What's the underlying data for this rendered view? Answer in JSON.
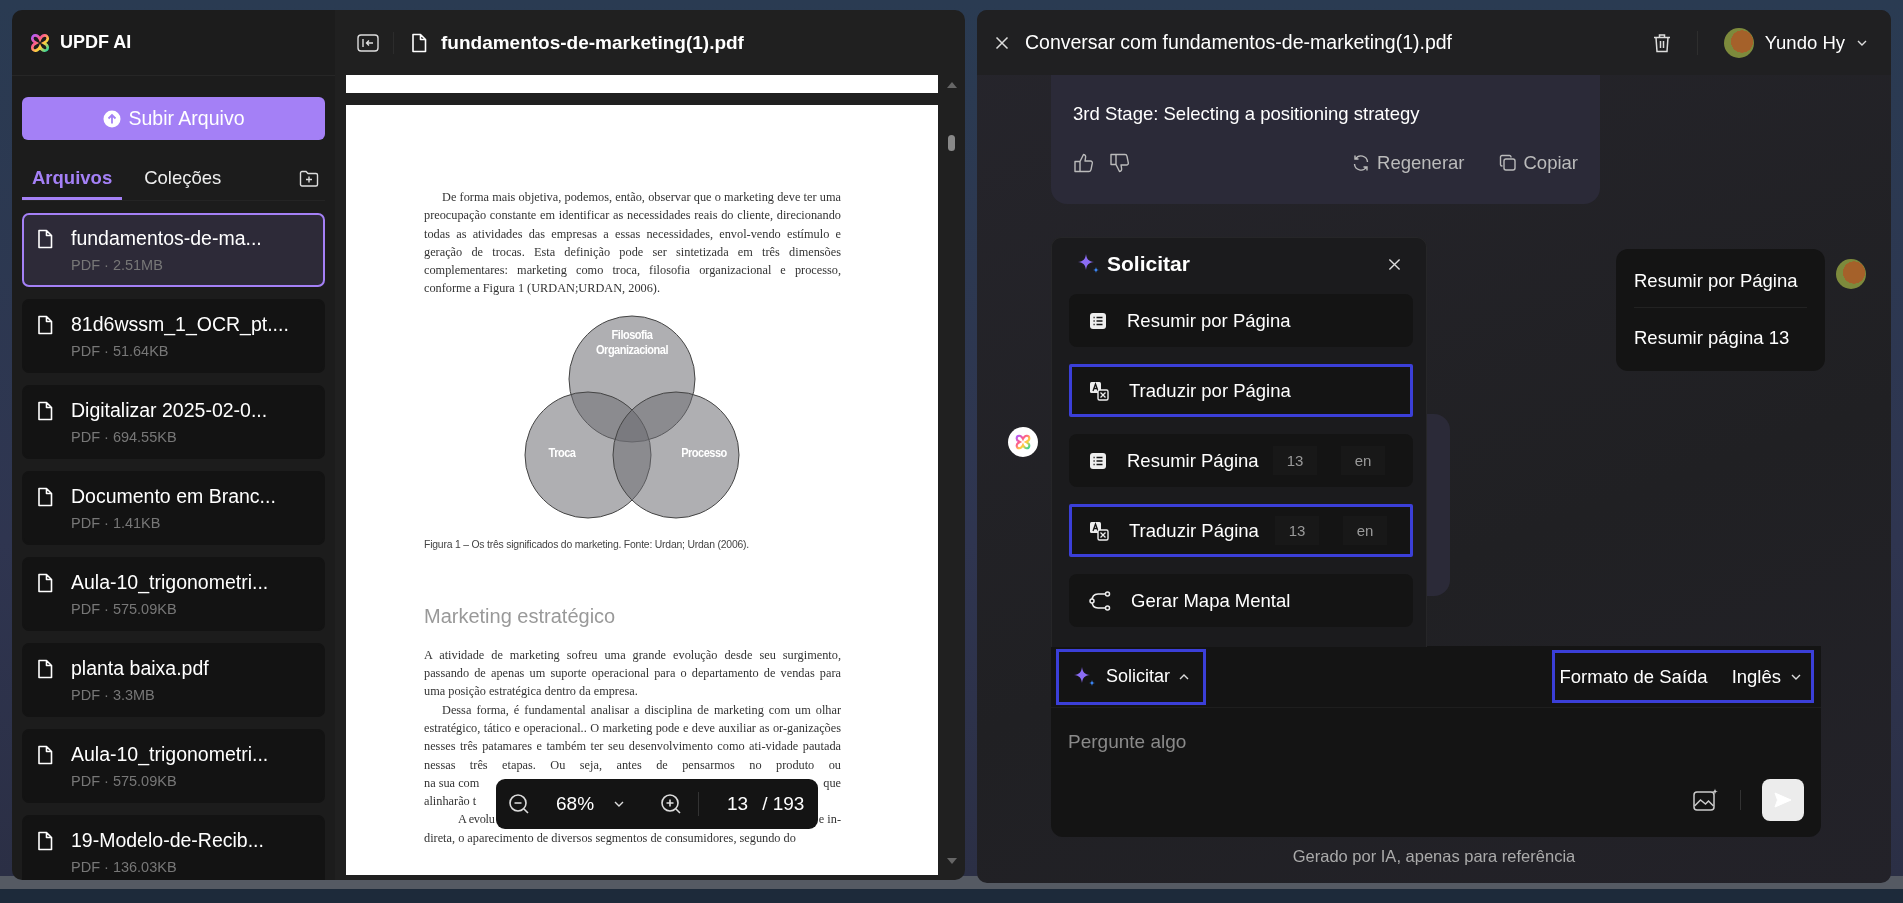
{
  "sidebar": {
    "brand": "UPDF AI",
    "upload_button": "Subir Arquivo",
    "tabs": [
      {
        "label": "Arquivos",
        "selected": true
      },
      {
        "label": "Coleções",
        "selected": false
      }
    ],
    "files": [
      {
        "name": "fundamentos-de-ma...",
        "meta": "PDF · 2.51MB",
        "selected": true
      },
      {
        "name": "81d6wssm_1_OCR_pt....",
        "meta": "PDF · 51.64KB",
        "selected": false
      },
      {
        "name": "Digitalizar 2025-02-0...",
        "meta": "PDF · 694.55KB",
        "selected": false
      },
      {
        "name": "Documento em Branc...",
        "meta": "PDF · 1.41KB",
        "selected": false
      },
      {
        "name": "Aula-10_trigonometri...",
        "meta": "PDF · 575.09KB",
        "selected": false
      },
      {
        "name": "planta baixa.pdf",
        "meta": "PDF · 3.3MB",
        "selected": false
      },
      {
        "name": "Aula-10_trigonometri...",
        "meta": "PDF · 575.09KB",
        "selected": false
      },
      {
        "name": "19-Modelo-de-Recib...",
        "meta": "PDF · 136.03KB",
        "selected": false
      }
    ]
  },
  "document": {
    "title": "fundamentos-de-marketing(1).pdf",
    "page": {
      "paragraph_1": "De forma mais objetiva, podemos, então, observar que o marketing deve ter uma preocupação constante em identificar as necessidades reais do cliente, direcionando todas as atividades das empresas a essas necessidades, envol-vendo estímulo e geração de trocas. Esta definição pode ser sintetizada em três dimensões complementares: marketing como troca, filosofia organizacional e processo, conforme a Figura 1 (URDAN;URDAN, 2006).",
      "figure_labels": [
        {
          "lines": [
            "Filosofia",
            "Organizacional"
          ]
        },
        {
          "lines": [
            "Troca"
          ]
        },
        {
          "lines": [
            "Processo"
          ]
        }
      ],
      "caption": "Figura 1 – Os três significados do marketing. Fonte: Urdan; Urdan (2006).",
      "heading": "Marketing estratégico",
      "paragraph_2": "A atividade de marketing sofreu uma grande evolução desde seu surgimento, passando de apenas um suporte operacional para o departamento de vendas para uma posição estratégica dentro da empresa.",
      "paragraph_3": "Dessa forma, é fundamental analisar a disciplina de marketing com um olhar estratégico, tático e operacional.. O marketing pode e deve auxiliar as or-ganizações nesses três patamares e também ter seu desenvolvimento como ati-vidade pautada nessas três etapas. Ou seja, antes de pensarmos no produto ou",
      "covered_lines": [
        {
          "kind": "line",
          "start": "na sua com",
          "end": "que"
        },
        {
          "kind": "line",
          "start": "alinharão t"
        },
        {
          "kind": "paragraph-start",
          "start": "A evolu",
          "end": "e in-"
        }
      ],
      "last_line": "direta, o aparecimento de diversos segmentos de consumidores, segundo do"
    },
    "zoom_bar": {
      "zoom": "68%",
      "page": "13",
      "total": "/ 193"
    }
  },
  "chat": {
    "title": "Conversar com fundamentos-de-marketing(1).pdf",
    "user_name": "Yundo Hy",
    "ai_message": {
      "text": "3rd Stage: Selecting a positioning strategy",
      "actions": [
        "Regenerar",
        "Copiar"
      ]
    },
    "prompt_menu": {
      "title": "Solicitar",
      "items": [
        {
          "kind": "summary",
          "label": "Resumir por Página",
          "highlighted": false
        },
        {
          "kind": "translate",
          "label": "Traduzir por Página",
          "highlighted": true
        },
        {
          "kind": "summary",
          "label": "Resumir Página",
          "page": "13",
          "language": "en",
          "highlighted": false
        },
        {
          "kind": "translate",
          "label": "Traduzir Página",
          "page": "13",
          "language": "en",
          "highlighted": true
        },
        {
          "kind": "mindmap",
          "label": "Gerar Mapa Mental",
          "highlighted": false
        }
      ]
    },
    "user_message": {
      "lines": [
        "Resumir por Página",
        "Resumir página 13"
      ]
    },
    "composer": {
      "prompt_button": {
        "label": "Solicitar",
        "expanded": true,
        "highlighted": true
      },
      "output_format": {
        "label": "Formato de Saída",
        "value": "Inglês",
        "highlighted": true
      },
      "placeholder": "Pergunte algo"
    },
    "footer": "Gerado por IA, apenas para referência"
  }
}
